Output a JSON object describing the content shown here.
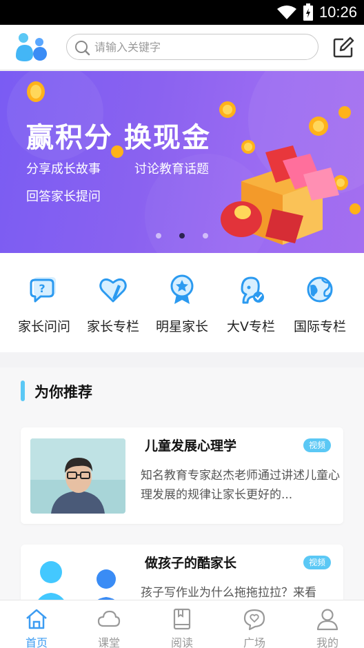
{
  "status_bar": {
    "time": "10:26"
  },
  "header": {
    "search_placeholder": "请输入关键字"
  },
  "banner": {
    "headline": "赢积分  换现金",
    "lines": [
      "分享成长故事",
      "讨论教育话题",
      "回答家长提问"
    ],
    "active_dot": 2,
    "dot_count": 3
  },
  "categories": [
    {
      "label": "家长问问",
      "icon": "question-chat-icon"
    },
    {
      "label": "家长专栏",
      "icon": "heart-pen-icon"
    },
    {
      "label": "明星家长",
      "icon": "star-medal-icon"
    },
    {
      "label": "大V专栏",
      "icon": "verified-user-icon"
    },
    {
      "label": "国际专栏",
      "icon": "globe-icon"
    }
  ],
  "recommend": {
    "title": "为你推荐",
    "cards": [
      {
        "title": "儿童发展心理学",
        "tag": "视频",
        "desc": "知名教育专家赵杰老师通过讲述儿童心理发展的规律让家长更好的..."
      },
      {
        "title": "做孩子的酷家长",
        "tag": "视频",
        "desc": "孩子写作业为什么拖拖拉拉？来看"
      }
    ]
  },
  "tabs": [
    {
      "label": "首页",
      "icon": "home-icon",
      "active": true
    },
    {
      "label": "课堂",
      "icon": "cloud-icon",
      "active": false
    },
    {
      "label": "阅读",
      "icon": "book-icon",
      "active": false
    },
    {
      "label": "广场",
      "icon": "chat-heart-icon",
      "active": false
    },
    {
      "label": "我的",
      "icon": "user-icon",
      "active": false
    }
  ],
  "colors": {
    "accent": "#3c9cf2",
    "tag": "#5bc8f5",
    "banner_from": "#7a5cf3",
    "banner_to": "#a46ef0",
    "icon_blue": "#3aa6f0"
  }
}
